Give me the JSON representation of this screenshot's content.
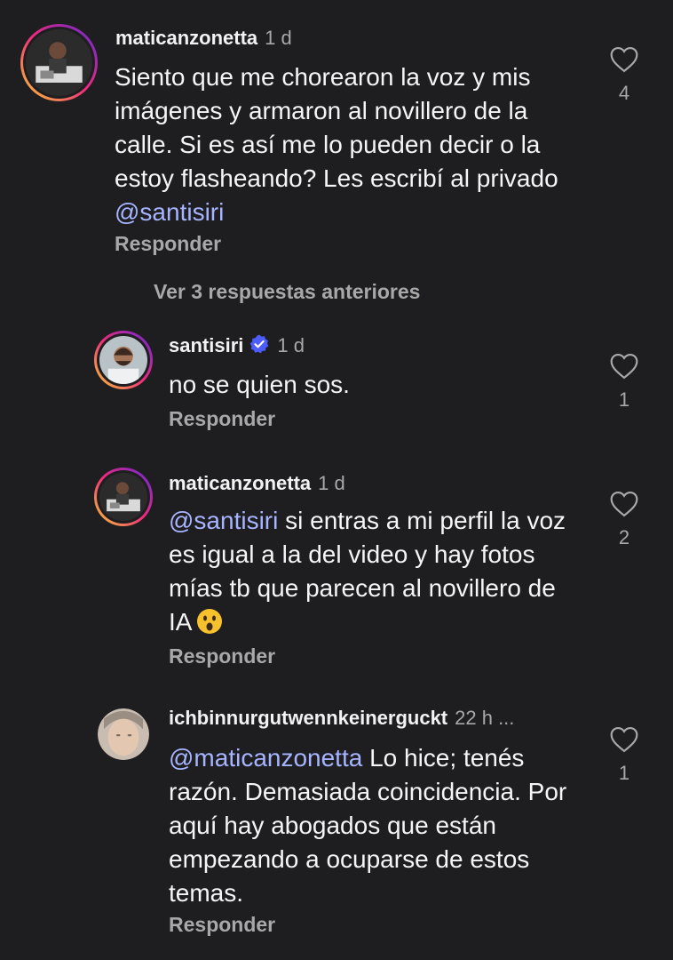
{
  "comments": [
    {
      "username": "maticanzonetta",
      "time": "1 d",
      "text": "Siento que me chorearon la voz y mis imágenes y armaron al novillero de la calle. Si es así me lo pueden decir o la estoy flasheando? Les escribí al privado ",
      "mention": "@santisiri",
      "reply_label": "Responder",
      "likes": "4"
    },
    {
      "username": "santisiri",
      "time": "1 d",
      "text": "no se quien sos.",
      "reply_label": "Responder",
      "likes": "1"
    },
    {
      "username": "maticanzonetta",
      "time": "1 d",
      "mention": "@santisiri",
      "text": " si entras a mi perfil la voz es igual a la del video y hay fotos mías tb que parecen al novillero de IA",
      "emoji": "astonished-face-icon",
      "reply_label": "Responder",
      "likes": "2"
    },
    {
      "username": "ichbinnurgutwennkeinerguckt",
      "time": "22 h ...",
      "mention": "@maticanzonetta",
      "text": " Lo hice; tenés razón. Demasiada coincidencia. Por aquí hay abogados que están empezando a ocuparse de estos temas.",
      "reply_label": "Responder",
      "likes": "1"
    }
  ],
  "view_previous": "Ver 3 respuestas anteriores",
  "colors": {
    "background": "#1e1e21",
    "mention": "#a7b4ff",
    "muted": "#a8a8a8",
    "verified": "#4d5cff"
  },
  "icons": [
    "heart-outline-icon",
    "verified-badge-icon"
  ]
}
